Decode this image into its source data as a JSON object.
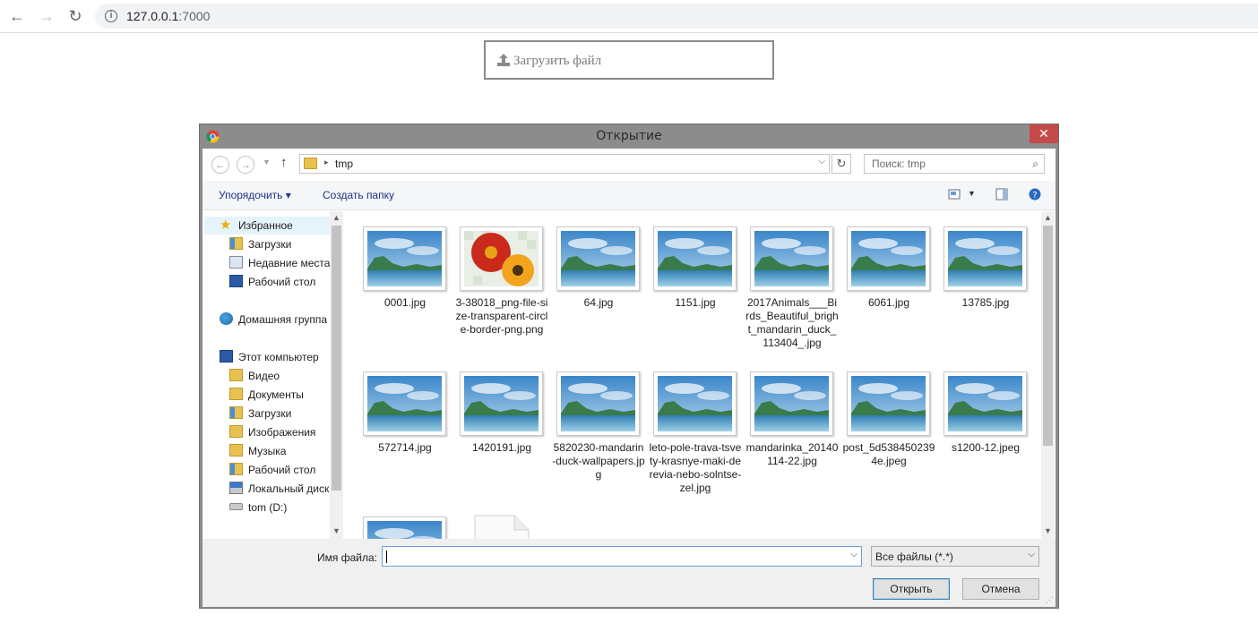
{
  "browser": {
    "url_host": "127.0.0.1",
    "url_port": ":7000"
  },
  "page": {
    "upload_label": "Загрузить файл"
  },
  "dialog": {
    "title": "Открытие",
    "close_glyph": "✕",
    "path_crumb": "tmp",
    "search_placeholder": "Поиск: tmp",
    "toolbar": {
      "organize": "Упорядочить ▾",
      "new_folder": "Создать папку"
    },
    "nav": {
      "favorites": "Избранное",
      "downloads": "Загрузки",
      "recent": "Недавние места",
      "desktop": "Рабочий стол",
      "homegroup": "Домашняя группа",
      "this_pc": "Этот компьютер",
      "video": "Видео",
      "documents": "Документы",
      "downloads2": "Загрузки",
      "pictures": "Изображения",
      "music": "Музыка",
      "desktop2": "Рабочий стол",
      "local_disk": "Локальный диск",
      "tom_drive": "tom (D:)"
    },
    "files": [
      {
        "name": "0001.jpg",
        "kind": "landscape"
      },
      {
        "name": "3-38018_png-file-size-transparent-circle-border-png.png",
        "kind": "flowers"
      },
      {
        "name": "64.jpg",
        "kind": "landscape"
      },
      {
        "name": "1151.jpg",
        "kind": "landscape"
      },
      {
        "name": "2017Animals___Birds_Beautiful_bright_mandarin_duck_113404_.jpg",
        "kind": "landscape"
      },
      {
        "name": "6061.jpg",
        "kind": "landscape"
      },
      {
        "name": "13785.jpg",
        "kind": "landscape"
      },
      {
        "name": "572714.jpg",
        "kind": "landscape"
      },
      {
        "name": "1420191.jpg",
        "kind": "landscape"
      },
      {
        "name": "5820230-mandarin-duck-wallpapers.jpg",
        "kind": "landscape"
      },
      {
        "name": "leto-pole-trava-tsvety-krasnye-maki-derevia-nebo-solntse-zel.jpg",
        "kind": "landscape"
      },
      {
        "name": "mandarinka_20140114-22.jpg",
        "kind": "landscape"
      },
      {
        "name": "post_5d5384502394e.jpeg",
        "kind": "landscape"
      },
      {
        "name": "s1200-12.jpeg",
        "kind": "landscape"
      },
      {
        "name": "",
        "kind": "landscape"
      },
      {
        "name": "",
        "kind": "document"
      }
    ],
    "filename_label": "Имя файла:",
    "filename_value": "",
    "filetype_value": "Все файлы (*.*)",
    "open_button": "Открыть",
    "cancel_button": "Отмена"
  },
  "colors": {
    "dialog_frame": "#8c8c8c",
    "close_red": "#c74a4a",
    "link_blue": "#1e3287"
  }
}
